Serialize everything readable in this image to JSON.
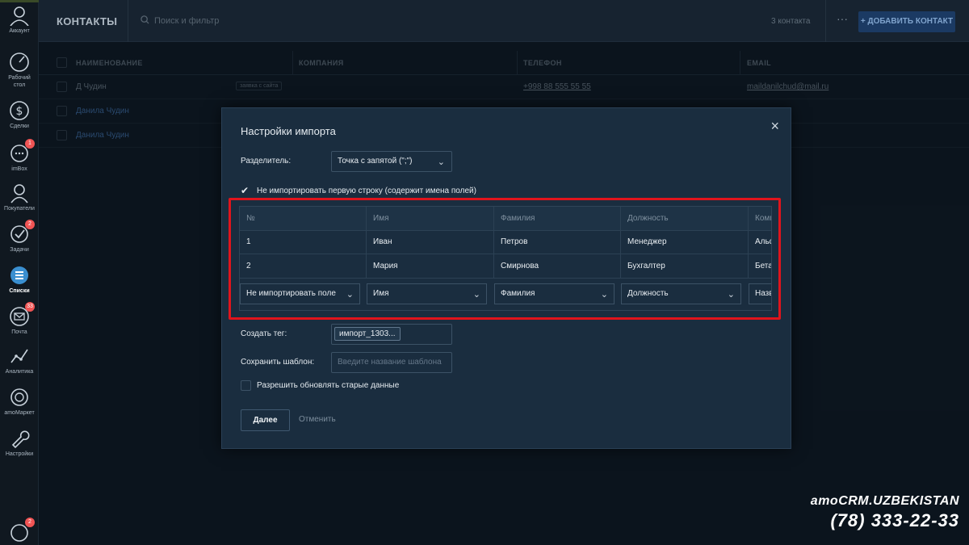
{
  "sidebar": {
    "items": [
      {
        "label": "Аккаунт",
        "icon": "user-icon"
      },
      {
        "label": "Рабочий стол",
        "icon": "dashboard-icon"
      },
      {
        "label": "Сделки",
        "icon": "dollar-icon"
      },
      {
        "label": "imBox",
        "icon": "chat-icon",
        "badge": "1"
      },
      {
        "label": "Покупатели",
        "icon": "customers-icon"
      },
      {
        "label": "Задачи",
        "icon": "check-icon",
        "badge": "2"
      },
      {
        "label": "Списки",
        "icon": "lists-icon",
        "active": true
      },
      {
        "label": "Почта",
        "icon": "mail-icon",
        "badge": "33"
      },
      {
        "label": "Аналитика",
        "icon": "analytics-icon"
      },
      {
        "label": "amoМаркет",
        "icon": "market-icon"
      },
      {
        "label": "Настройки",
        "icon": "settings-icon"
      }
    ],
    "bell_badge": "2"
  },
  "header": {
    "title": "КОНТАКТЫ",
    "search_placeholder": "Поиск и фильтр",
    "count": "3 контакта",
    "more": "···",
    "add_button": "+ ДОБАВИТЬ КОНТАКТ"
  },
  "table": {
    "columns": [
      "НАИМЕНОВАНИЕ",
      "КОМПАНИЯ",
      "ТЕЛЕФОН",
      "EMAIL"
    ],
    "rows": [
      {
        "name": "Д Чудин",
        "tag": "заявка с сайта",
        "phone": "+998 88 555 55 55",
        "email": "maildanilchud@mail.ru"
      },
      {
        "name": "Данила Чудин",
        "tag": "",
        "phone": "",
        "email": ""
      },
      {
        "name": "Данила Чудин",
        "tag": "",
        "phone": "",
        "email": ""
      }
    ]
  },
  "modal": {
    "title": "Настройки импорта",
    "close": "×",
    "separator_label": "Разделитель:",
    "separator_value": "Точка с запятой (\";\")",
    "skip_first_row_label": "Не импортировать первую строку (содержит имена полей)",
    "skip_first_row_checked": true,
    "grid": {
      "headers": [
        "№",
        "Имя",
        "Фамилия",
        "Должность",
        "Компания"
      ],
      "rows": [
        [
          "1",
          "Иван",
          "Петров",
          "Менеджер",
          "Альфа"
        ],
        [
          "2",
          "Мария",
          "Смирнова",
          "Бухгалтер",
          "Бета"
        ]
      ],
      "mappings": [
        "Не импортировать поле",
        "Имя",
        "Фамилия",
        "Должность",
        "Название"
      ]
    },
    "tag_label": "Создать тег:",
    "tag_value": "импорт_1303...",
    "template_label": "Сохранить шаблон:",
    "template_placeholder": "Введите название шаблона",
    "allow_update_label": "Разрешить обновлять старые данные",
    "next_button": "Далее",
    "cancel_button": "Отменить"
  },
  "brand": {
    "name": "amoCRM.UZBEKISTAN",
    "phone": "(78) 333-22-33"
  },
  "colors": {
    "accent": "#1b3a63",
    "highlight_border": "#e0141c",
    "badge": "#f05454"
  }
}
